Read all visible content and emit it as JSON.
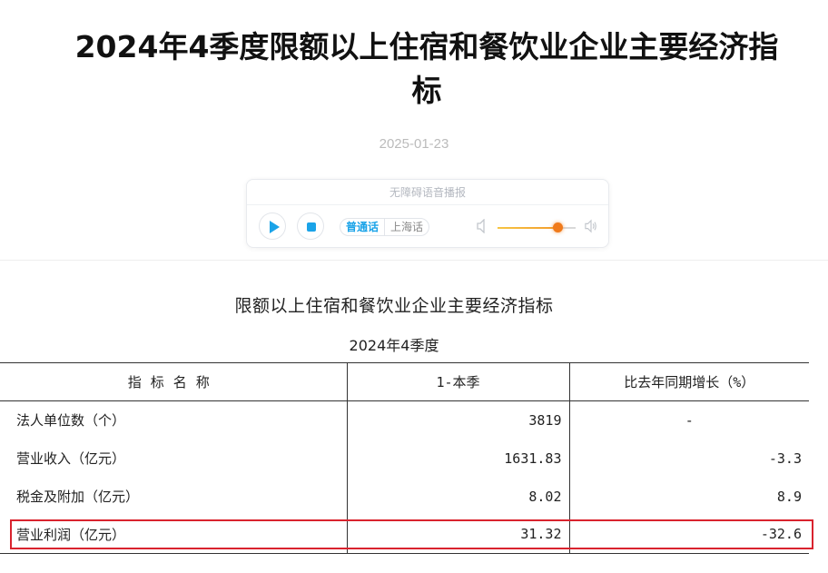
{
  "article": {
    "title": "2024年4季度限额以上住宿和餐饮业企业主要经济指标",
    "date": "2025-01-23"
  },
  "audio_player": {
    "header": "无障碍语音播报",
    "lang_options": [
      "普通话",
      "上海话"
    ],
    "selected_lang": "普通话",
    "volume_level": 0.8,
    "icons": [
      "play-icon",
      "stop-icon",
      "volume-low-icon",
      "volume-high-icon"
    ]
  },
  "table": {
    "title": "限额以上住宿和餐饮业企业主要经济指标",
    "subtitle": "2024年4季度",
    "headers": [
      "指标名称",
      "1-本季",
      "比去年同期增长（%）"
    ],
    "rows": [
      [
        "法人单位数（个）",
        "3819",
        "-"
      ],
      [
        "营业收入（亿元）",
        "1631.83",
        "-3.3"
      ],
      [
        "税金及附加（亿元）",
        "8.02",
        "8.9"
      ],
      [
        "营业利润（亿元）",
        "31.32",
        "-32.6"
      ]
    ]
  },
  "colors": {
    "accent": "#1aa3e8",
    "volume_knob": "#f07a1a",
    "highlight": "#d9232e"
  }
}
